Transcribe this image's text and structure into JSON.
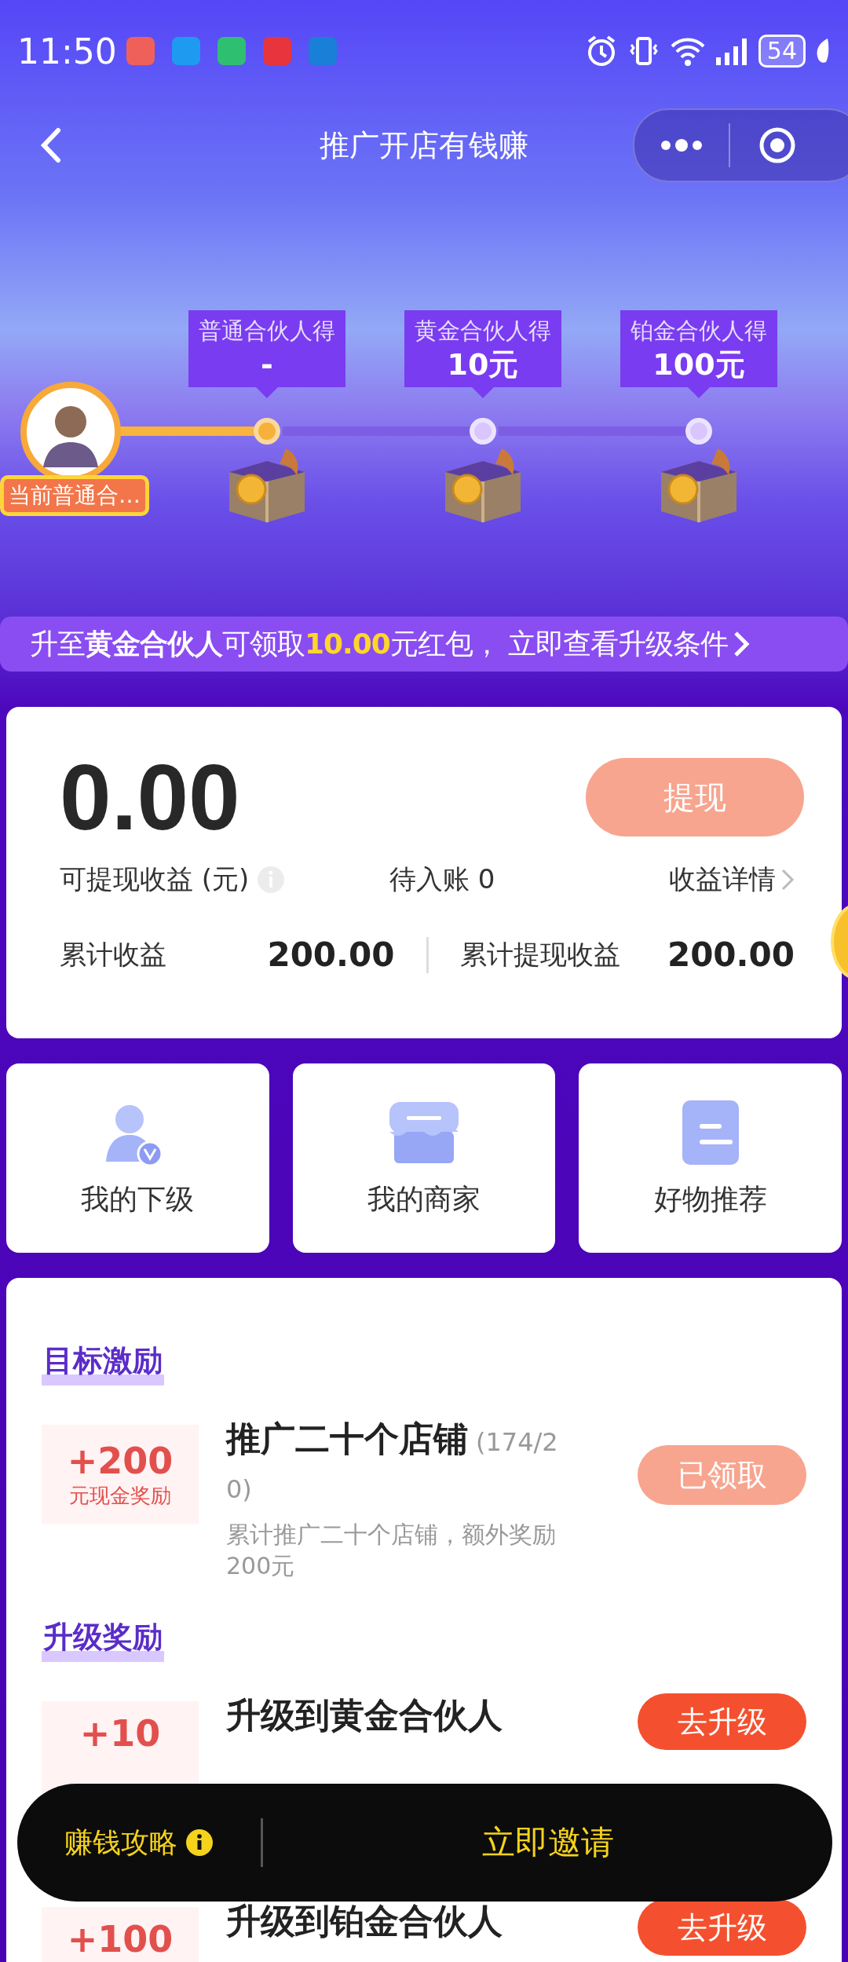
{
  "status_bar": {
    "time": "11:50",
    "battery": "54",
    "apps": [
      {
        "color": "#f0605a"
      },
      {
        "color": "#1e9bf0"
      },
      {
        "color": "#2fbf71"
      },
      {
        "color": "#e8343c"
      },
      {
        "color": "#1a7fd6"
      }
    ]
  },
  "nav": {
    "title": "推广开店有钱赚"
  },
  "tiers": [
    {
      "label": "普通合伙人得",
      "reward": "-",
      "reached": true
    },
    {
      "label": "黄金合伙人得",
      "reward": "10元",
      "reached": false
    },
    {
      "label": "铂金合伙人得",
      "reward": "100元",
      "reached": false
    }
  ],
  "current_level": {
    "badge": "当前普通合…"
  },
  "upgrade_banner": {
    "segments": [
      {
        "kind": "plain",
        "text": "升至"
      },
      {
        "kind": "bold",
        "text": "黄金合伙人"
      },
      {
        "kind": "plain",
        "text": "可领取"
      },
      {
        "kind": "highlight",
        "text": "10.00"
      },
      {
        "kind": "plain",
        "text": "元红包， 立即查看升级条件"
      }
    ]
  },
  "earnings": {
    "amount": "0.00",
    "withdraw_button": "提现",
    "available_label": "可提现收益 (元)",
    "pending": "待入账 0",
    "details_link": "收益详情",
    "totals": [
      {
        "label": "累计收益",
        "value": "200.00"
      },
      {
        "label": "累计提现收益",
        "value": "200.00"
      }
    ]
  },
  "shortcuts": [
    {
      "label": "我的下级",
      "kind": "person"
    },
    {
      "label": "我的商家",
      "kind": "store"
    },
    {
      "label": "好物推荐",
      "kind": "list"
    }
  ],
  "sections": [
    {
      "title": "目标激励",
      "items": [
        {
          "amount": "+200",
          "unit": "元现金奖励",
          "title": "推广二十个店铺",
          "progress": "(174/20)",
          "description": "累计推广二十个店铺，额外奖励200元",
          "button": "已领取",
          "claimed": true
        }
      ]
    },
    {
      "title": "升级奖励",
      "items": [
        {
          "amount": "+10",
          "title": "升级到黄金合伙人",
          "button": "去升级",
          "claimed": false
        },
        {
          "amount": "+100",
          "title": "升级到铂金合伙人",
          "button": "去升级",
          "claimed": false
        }
      ]
    }
  ],
  "bottom_bar": {
    "guide": "赚钱攻略",
    "invite": "立即邀请"
  }
}
